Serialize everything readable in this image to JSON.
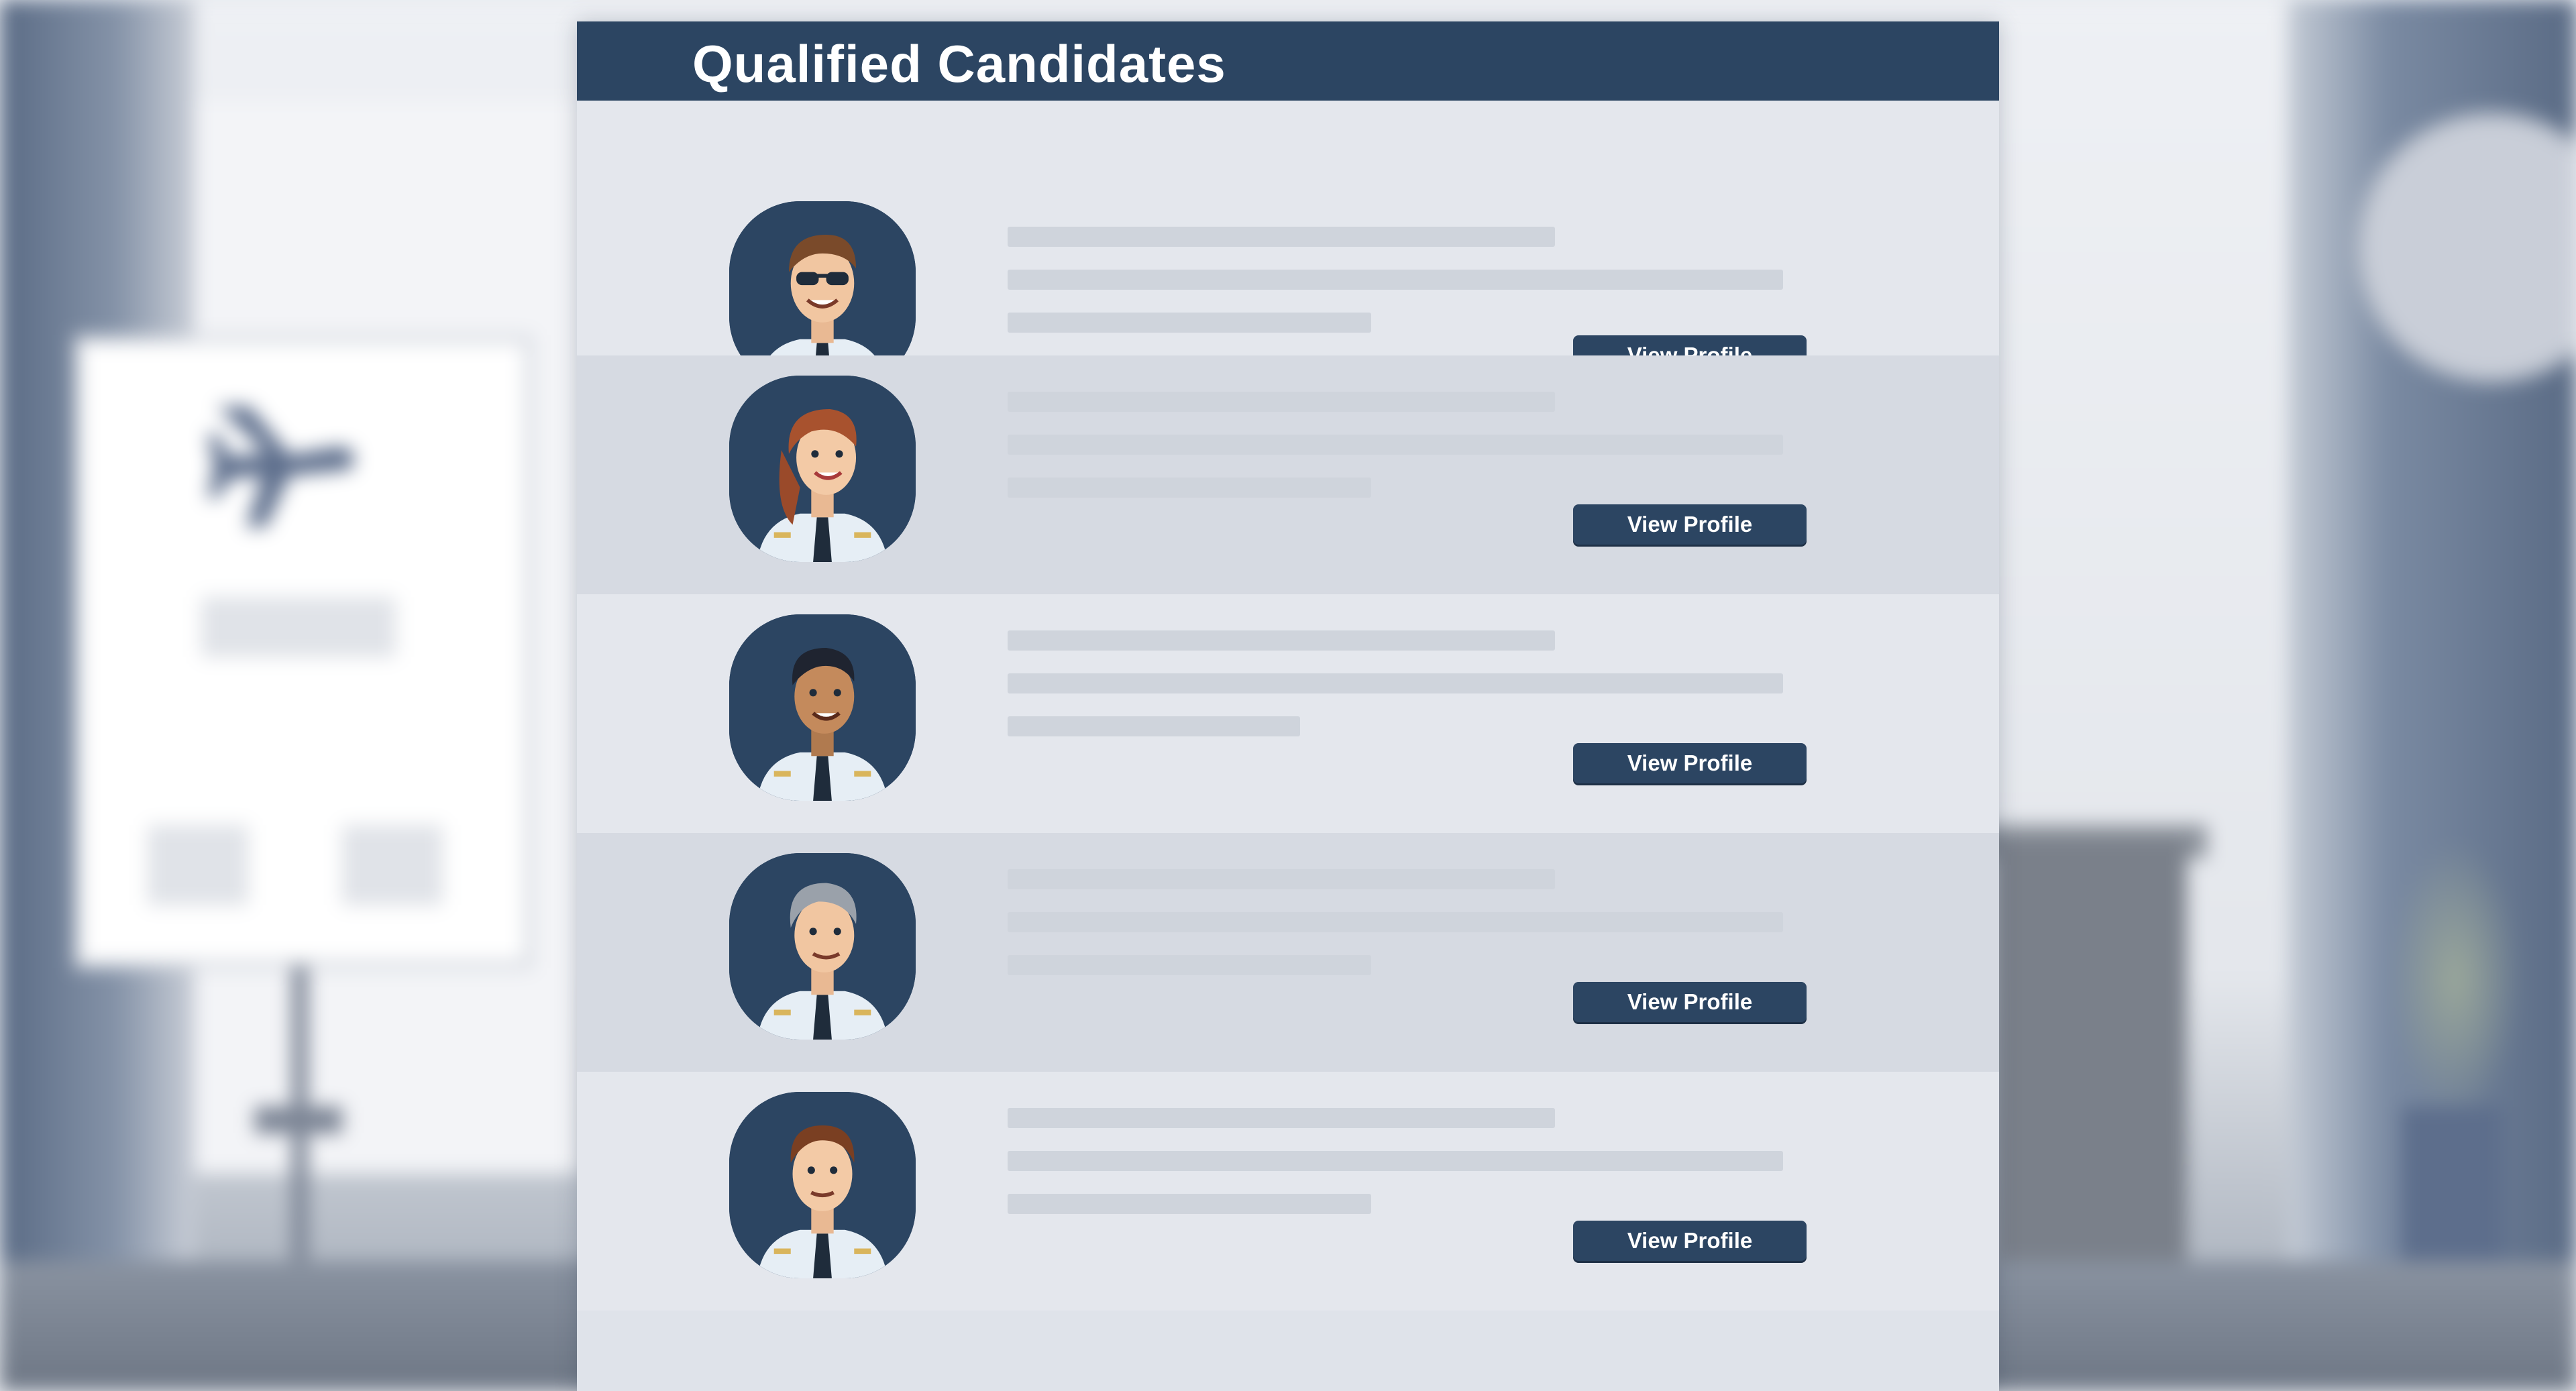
{
  "page": {
    "title": "Qualified Candidates"
  },
  "candidates": [
    {
      "avatar": "pilot-sunglasses-avatar",
      "button_label": "View Profile"
    },
    {
      "avatar": "pilot-female-avatar",
      "button_label": "View Profile"
    },
    {
      "avatar": "pilot-dark-hair-avatar",
      "button_label": "View Profile"
    },
    {
      "avatar": "pilot-gray-hair-avatar",
      "button_label": "View Profile"
    },
    {
      "avatar": "pilot-brown-hair-avatar",
      "button_label": "View Profile"
    }
  ],
  "colors": {
    "header": "#2c4562",
    "button": "#2c4562",
    "button_text": "#ffffff",
    "placeholder_line": "#cfd4dc"
  }
}
